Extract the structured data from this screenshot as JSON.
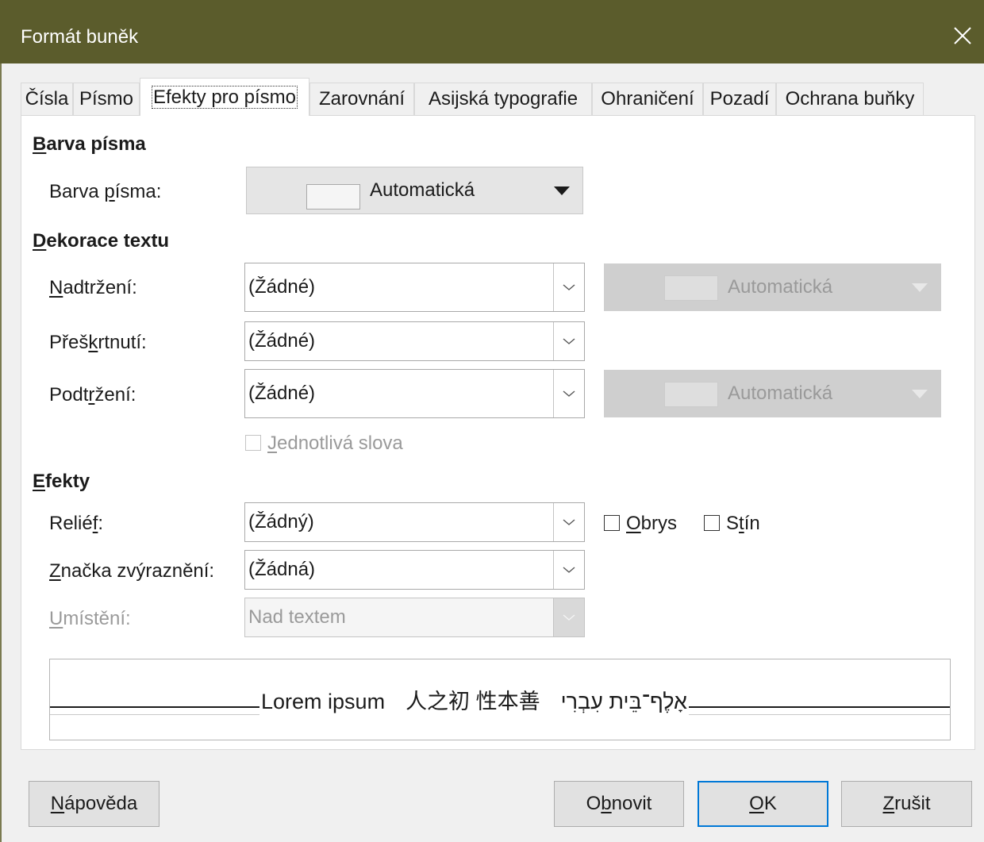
{
  "window": {
    "title": "Formát buněk"
  },
  "tabs": [
    {
      "label": "Čísla"
    },
    {
      "label": "Písmo"
    },
    {
      "label": "Efekty pro písmo"
    },
    {
      "label": "Zarovnání"
    },
    {
      "label": "Asijská typografie"
    },
    {
      "label": "Ohraničení"
    },
    {
      "label": "Pozadí"
    },
    {
      "label": "Ochrana buňky"
    }
  ],
  "font_color": {
    "heading": {
      "ul": "B",
      "rest": "arva písma"
    },
    "label": {
      "pre": "Barva ",
      "ul": "p",
      "post": "ísma:"
    },
    "value": "Automatická"
  },
  "decoration": {
    "heading": {
      "ul": "D",
      "rest": "ekorace textu"
    },
    "overline": {
      "label": {
        "pre": "",
        "ul": "N",
        "post": "adtržení:"
      },
      "value": "(Žádné)",
      "color": "Automatická"
    },
    "strikethrough": {
      "label": {
        "pre": "Přeš",
        "ul": "k",
        "post": "rtnutí:"
      },
      "value": "(Žádné)"
    },
    "underline": {
      "label": {
        "pre": "Podt",
        "ul": "r",
        "post": "žení:"
      },
      "value": "(Žádné)",
      "color": "Automatická"
    },
    "individual_words": {
      "pre": "",
      "ul": "J",
      "post": "ednotlivá slova"
    }
  },
  "effects": {
    "heading": {
      "ul": "E",
      "rest": "fekty"
    },
    "relief": {
      "label": {
        "pre": "Relié",
        "ul": "f",
        "post": ":"
      },
      "value": "(Žádný)"
    },
    "outline": {
      "pre": "",
      "ul": "O",
      "post": "brys"
    },
    "shadow": {
      "pre": "S",
      "ul": "t",
      "post": "ín"
    },
    "emphasis": {
      "label": {
        "pre": "",
        "ul": "Z",
        "post": "načka zvýraznění:"
      },
      "value": "(Žádná)"
    },
    "position": {
      "label": {
        "pre": "",
        "ul": "U",
        "post": "místění:"
      },
      "value": "Nad textem"
    }
  },
  "preview": {
    "latin": "Lorem ipsum",
    "cjk": "人之初 性本善",
    "hebrew": "אָלֶף־בֵּית עִבְרִי"
  },
  "buttons": {
    "help": {
      "pre": "",
      "ul": "N",
      "post": "ápověda"
    },
    "reset": {
      "pre": "O",
      "ul": "b",
      "post": "novit"
    },
    "ok": {
      "pre": "",
      "ul": "O",
      "post": "K"
    },
    "cancel": {
      "pre": "",
      "ul": "Z",
      "post": "rušit"
    }
  },
  "colors": {
    "titlebar": "#5b5c2c",
    "default_button_border": "#0078d7"
  }
}
